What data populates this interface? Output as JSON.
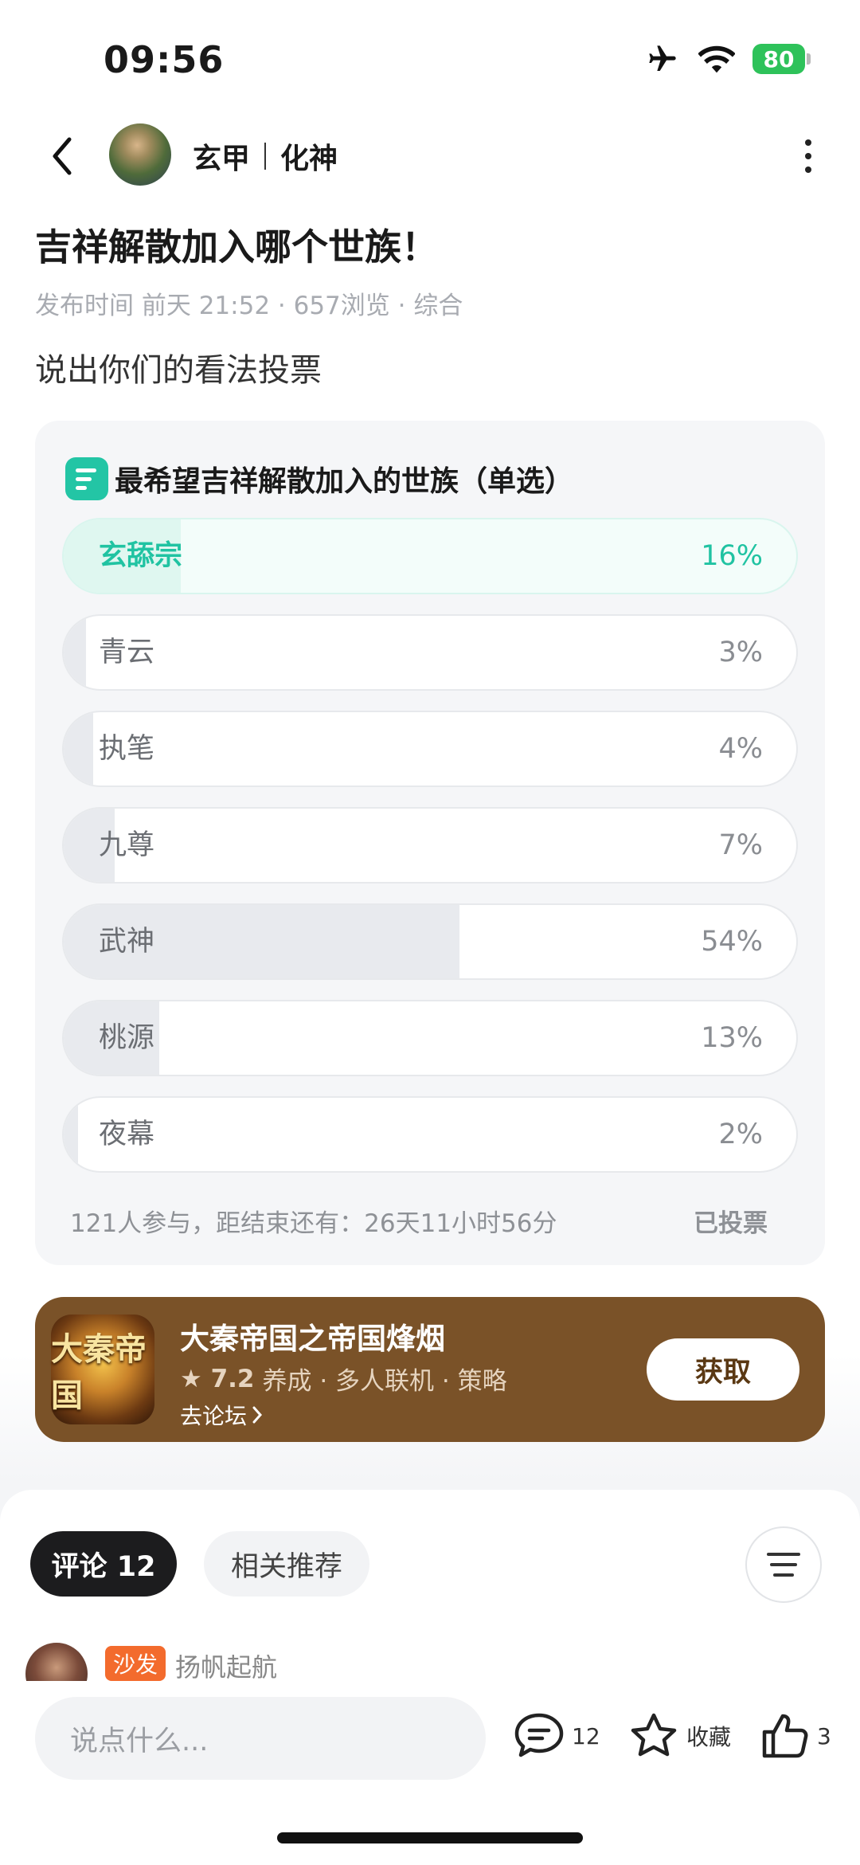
{
  "status_bar": {
    "time": "09:56",
    "battery": "80"
  },
  "header": {
    "author_name": "玄甲",
    "author_tag": "化神"
  },
  "post": {
    "title": "吉祥解散加入哪个世族！",
    "meta": "发布时间 前天 21:52 · 657浏览 · 综合",
    "body": "说出你们的看法投票"
  },
  "poll": {
    "title": "最希望吉祥解散加入的世族（单选）",
    "options": [
      {
        "label": "玄舔宗",
        "percent": "16%",
        "value": 16,
        "selected": true
      },
      {
        "label": "青云",
        "percent": "3%",
        "value": 3,
        "selected": false
      },
      {
        "label": "执笔",
        "percent": "4%",
        "value": 4,
        "selected": false
      },
      {
        "label": "九尊",
        "percent": "7%",
        "value": 7,
        "selected": false
      },
      {
        "label": "武神",
        "percent": "54%",
        "value": 54,
        "selected": false
      },
      {
        "label": "桃源",
        "percent": "13%",
        "value": 13,
        "selected": false
      },
      {
        "label": "夜幕",
        "percent": "2%",
        "value": 2,
        "selected": false
      }
    ],
    "footer": "121人参与，距结束还有：26天11小时56分",
    "status": "已投票"
  },
  "game_card": {
    "icon_text": "大秦帝国",
    "name": "大秦帝国之帝国烽烟",
    "score": "★ 7.2",
    "tags": "养成 · 多人联机 · 策略",
    "forum_link": "去论坛",
    "get_button": "获取"
  },
  "comments": {
    "tab_active": "评论 12",
    "tab_other": "相关推荐",
    "first": {
      "badge": "沙发",
      "name": "扬帆起航"
    }
  },
  "bottom_bar": {
    "input_placeholder": "说点什么...",
    "comment_count": "12",
    "favorite_label": "收藏",
    "like_count": "3"
  },
  "colors": {
    "accent": "#23c5a5",
    "game_card_bg": "#7a5228",
    "badge": "#f36b2d"
  }
}
